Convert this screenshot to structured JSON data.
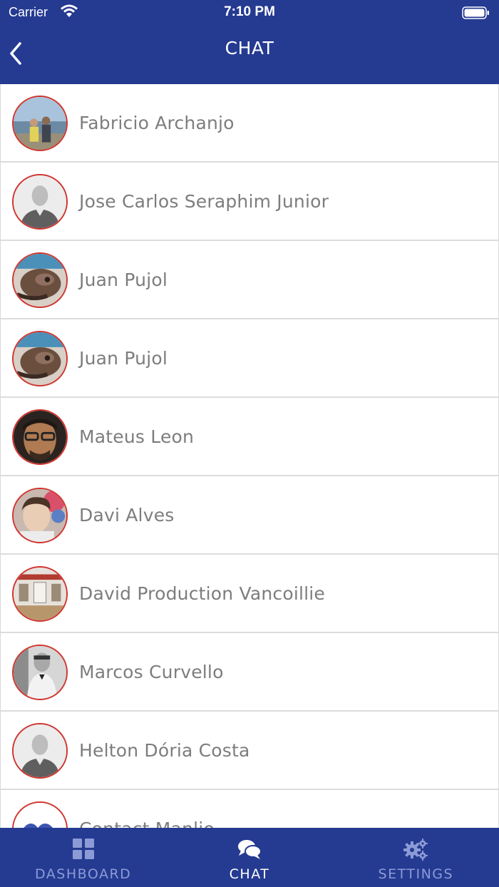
{
  "status_bar": {
    "carrier": "Carrier",
    "time": "7:10 PM",
    "icons": [
      "wifi-icon",
      "battery-icon"
    ]
  },
  "nav": {
    "title": "CHAT",
    "back_icon": "chevron-left-icon"
  },
  "colors": {
    "header": "#253a91",
    "avatar_border": "#d0352f",
    "name_text": "#7d7d7d",
    "tab_inactive": "#8c9bd6",
    "tab_active": "#ffffff"
  },
  "contacts": [
    {
      "name": "Fabricio Archanjo",
      "avatar": "photo"
    },
    {
      "name": "Jose Carlos Seraphim Junior",
      "avatar": "placeholder"
    },
    {
      "name": "Juan Pujol",
      "avatar": "photo"
    },
    {
      "name": "Juan Pujol",
      "avatar": "photo"
    },
    {
      "name": "Mateus Leon",
      "avatar": "photo"
    },
    {
      "name": "Davi Alves",
      "avatar": "photo"
    },
    {
      "name": "David Production Vancoillie",
      "avatar": "photo"
    },
    {
      "name": "Marcos Curvello",
      "avatar": "photo"
    },
    {
      "name": "Helton Dória Costa",
      "avatar": "placeholder"
    },
    {
      "name": "Contact Manlio",
      "avatar": "photo"
    }
  ],
  "tabs": [
    {
      "label": "DASHBOARD",
      "icon": "grid-icon",
      "active": false
    },
    {
      "label": "CHAT",
      "icon": "chat-bubbles-icon",
      "active": true
    },
    {
      "label": "SETTINGS",
      "icon": "gears-icon",
      "active": false
    }
  ]
}
